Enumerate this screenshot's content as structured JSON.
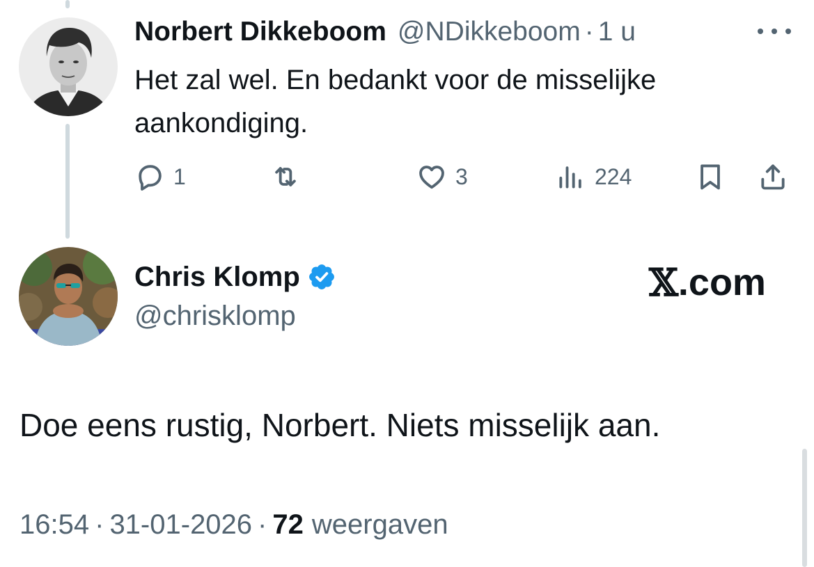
{
  "reply": {
    "author_name": "Norbert Dikkeboom",
    "author_handle": "@NDikkeboom",
    "separator": "·",
    "time": "1 u",
    "text": "Het zal wel. En bedankt voor de misselijke aankondiging.",
    "actions": {
      "reply_count": "1",
      "retweet_count": "",
      "like_count": "3",
      "view_count": "224"
    }
  },
  "main": {
    "author_name": "Chris Klomp",
    "author_handle": "@chrisklomp",
    "verified": true,
    "brand_x": "𝕏",
    "brand_suffix": ".com",
    "text": "Doe eens rustig, Norbert. Niets misselijk aan.",
    "time": "16:54",
    "date": "31-01-2026",
    "separator": "·",
    "view_count": "72",
    "view_label": "weergaven"
  },
  "icons": {
    "more": "more-icon",
    "reply": "reply-icon",
    "retweet": "retweet-icon",
    "like": "heart-icon",
    "views": "views-icon",
    "bookmark": "bookmark-icon",
    "share": "share-icon",
    "verified": "verified-badge-icon"
  },
  "colors": {
    "text_primary": "#0f1419",
    "text_secondary": "#536471",
    "verified_blue": "#1d9bf0",
    "thread_line": "#cfd9de"
  }
}
